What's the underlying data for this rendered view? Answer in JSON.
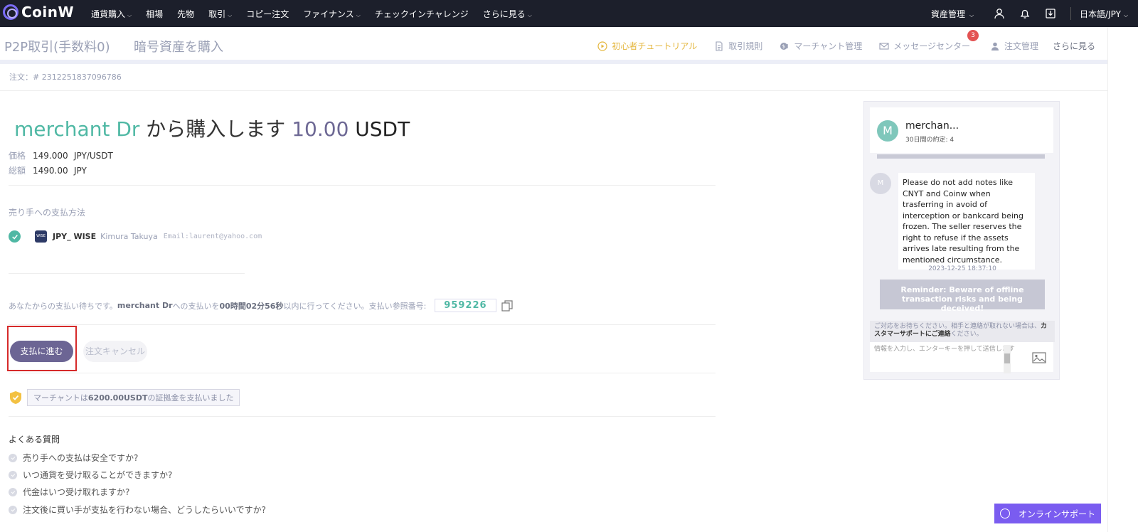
{
  "nav": {
    "logo": "CoinW",
    "items": [
      {
        "label": "通貨購入",
        "chev": true
      },
      {
        "label": "相場",
        "chev": false
      },
      {
        "label": "先物",
        "chev": false
      },
      {
        "label": "取引",
        "chev": true
      },
      {
        "label": "コピー注文",
        "chev": false
      },
      {
        "label": "ファイナンス",
        "chev": true
      },
      {
        "label": "チェックインチャレンジ",
        "chev": false
      },
      {
        "label": "さらに見る",
        "chev": true
      }
    ],
    "asset": "資産管理",
    "lang": "日本語/JPY"
  },
  "subhead": {
    "p2p": "P2P取引(手数料0)",
    "buy": "暗号資産を購入",
    "links": {
      "tutorial": "初心者チュートリアル",
      "rules": "取引規則",
      "merchant": "マーチャント管理",
      "messages": "メッセージセンター",
      "message_count": "3",
      "orders": "注文管理",
      "more": "さらに見る"
    }
  },
  "order": {
    "label": "注文：# 2312251837096786"
  },
  "title": {
    "merchant": "merchant Dr",
    "mid": " から購入します ",
    "amount": "10.00",
    "currency": " USDT"
  },
  "price": {
    "label": "価格",
    "value": "149.000",
    "unit": "JPY/USDT"
  },
  "total": {
    "label": "総額",
    "value": "1490.00",
    "unit": "JPY"
  },
  "payment": {
    "label": "売り手への支払方法",
    "icon_text": "WISE",
    "method": "JPY_ WISE",
    "person": "Kimura Takuya",
    "email": "Email:laurent@yahoo.com"
  },
  "waiting": {
    "prefix": "あなたからの支払い待ちです。",
    "merchant": "merchant Dr",
    "mid": "への支払いを",
    "time": "00時間02分56秒",
    "suffix": "以内に行ってください。支払い参照番号:",
    "ref": "959226"
  },
  "buttons": {
    "pay": "支払に進む",
    "cancel": "注文キャンセル"
  },
  "deposit": {
    "prefix": "マーチャントは",
    "amount": "6200.00USDT",
    "suffix": "の証拠金を支払いました"
  },
  "faq": {
    "title": "よくある質問",
    "items": [
      "売り手への支払は安全ですか?",
      "いつ通貨を受け取ることができますか?",
      "代金はいつ受け取れますか?",
      "注文後に買い手が支払を行わない場合、どうしたらいいですか?"
    ]
  },
  "chat": {
    "avatar": "M",
    "name": "merchan...",
    "sub": "30日間の約定: 4",
    "msg_avatar": "M",
    "message": "Please do not add notes like CNYT and Coinw when trasferring in avoid of interception or bankcard being frozen. The seller reserves the right to refuse if the assets arrives late resulting from the mentioned circumstance.",
    "time": "2023-12-25 18:37:10",
    "reminder": "Reminder: Beware of offline transaction risks and being deceived!",
    "notice_pre": "ご対応をお待ちください。相手と連絡が取れない場合は、",
    "notice_link": "カスタマーサポートにご連絡",
    "notice_post": "ください。",
    "input_placeholder": "情報を入力し、エンターキーを押して送信します"
  },
  "support": {
    "label": "オンラインサポート"
  },
  "colors": {
    "accent": "#4fb8a4",
    "primary_btn": "#6c6594",
    "nav_bg": "#1c1f2b",
    "highlight_box": "#d62a2a",
    "support": "#7a5cf0"
  }
}
